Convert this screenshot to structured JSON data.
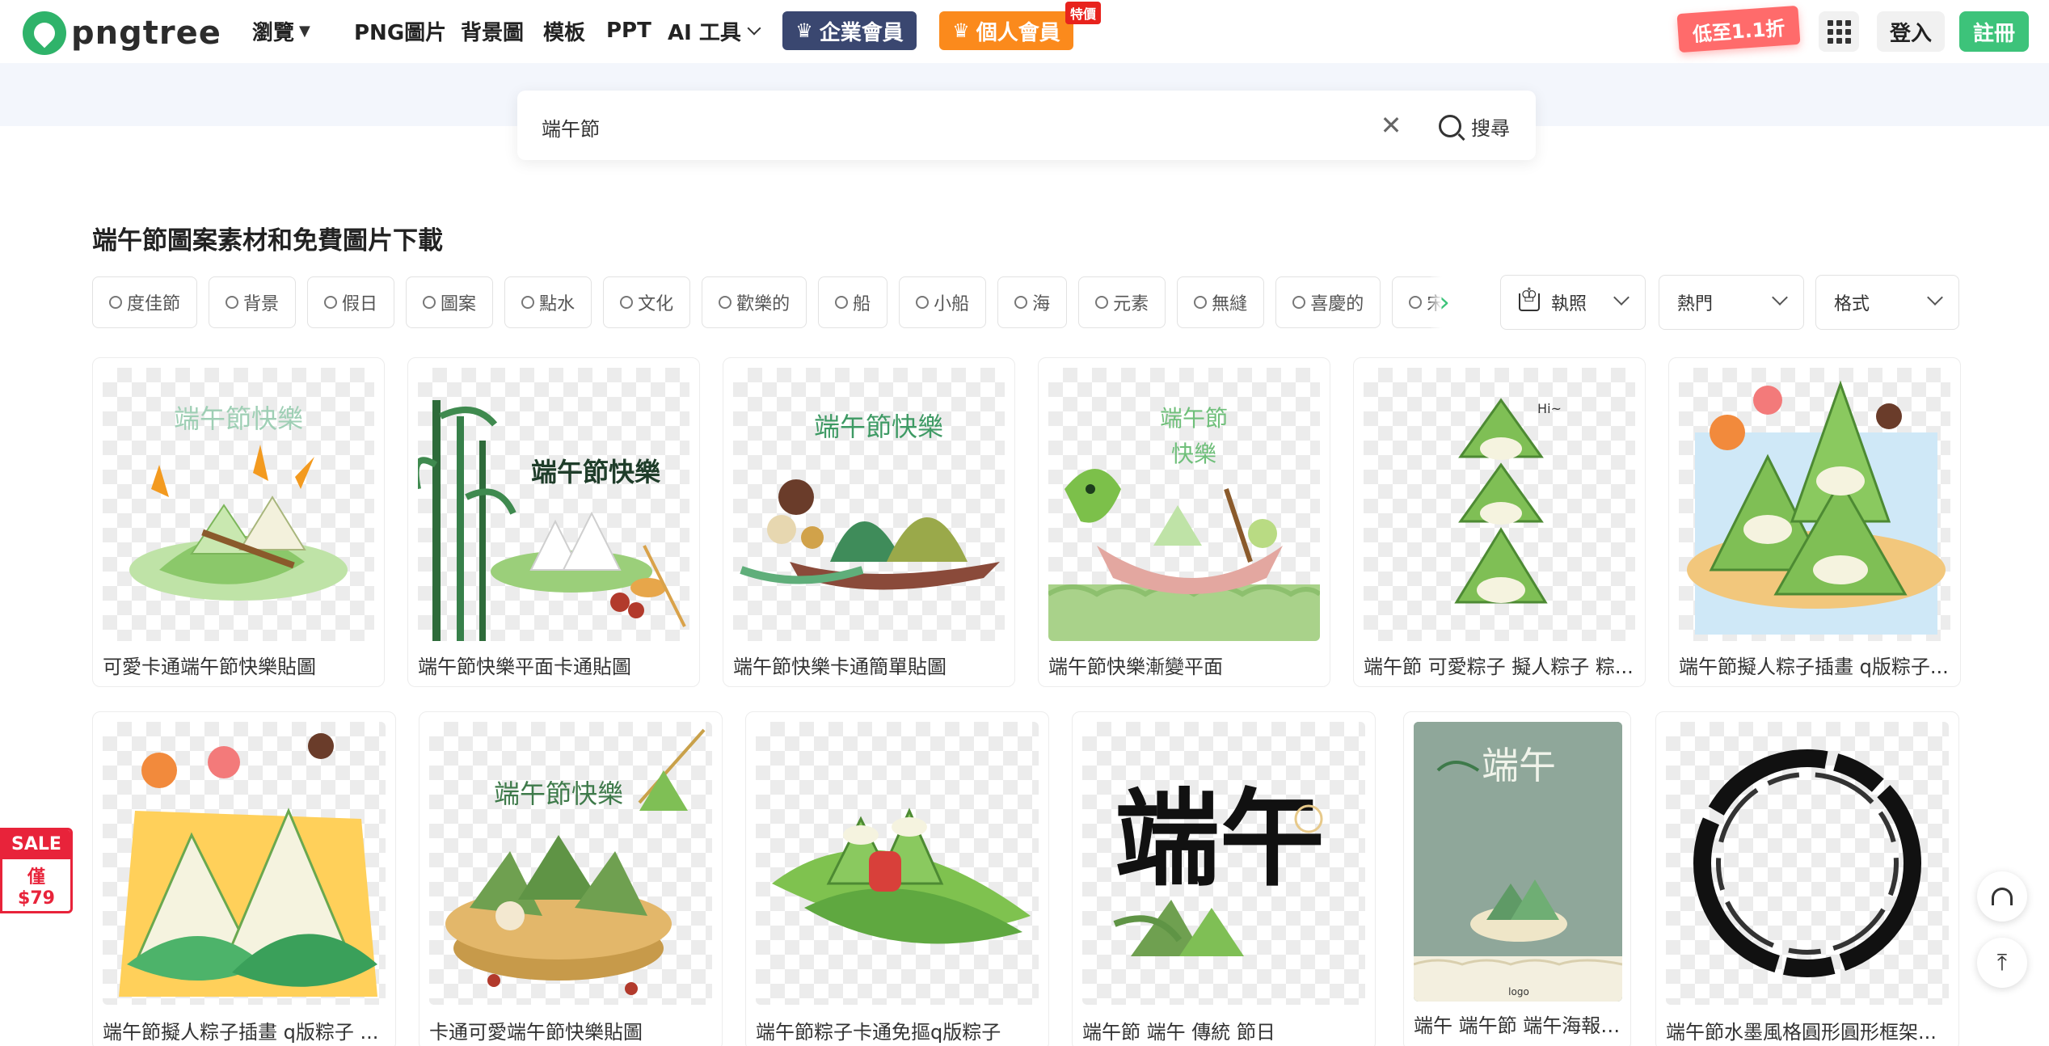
{
  "header": {
    "logo_text": "pngtree",
    "nav": [
      {
        "label": "瀏覽"
      },
      {
        "label": "PNG圖片"
      },
      {
        "label": "背景圖"
      },
      {
        "label": "模板"
      },
      {
        "label": "PPT"
      },
      {
        "label": "AI 工具"
      }
    ],
    "enterprise_label": "企業會員",
    "personal_label": "個人會員",
    "personal_badge": "特價",
    "promo_label": "低至1.1折",
    "login_label": "登入",
    "register_label": "註冊"
  },
  "search": {
    "value": "端午節",
    "button_label": "搜尋"
  },
  "page_title": "端午節圖案素材和免費圖片下載",
  "tags": [
    "度佳節",
    "背景",
    "假日",
    "圖案",
    "點水",
    "文化",
    "歡樂的",
    "船",
    "小船",
    "海",
    "元素",
    "無縫",
    "喜慶的",
    "宋"
  ],
  "filters": {
    "license": "執照",
    "sort": "熱門",
    "format": "格式"
  },
  "cards_row1": [
    {
      "title": "可愛卡通端午節快樂貼圖",
      "art_text": "端午節快樂"
    },
    {
      "title": "端午節快樂平面卡通貼圖",
      "art_text": "端午節快樂"
    },
    {
      "title": "端午節快樂卡通簡單貼圖",
      "art_text": "端午節快樂"
    },
    {
      "title": "端午節快樂漸變平面",
      "art_text": "端午節",
      "art_text2": "快樂"
    },
    {
      "title": "端午節 可愛粽子 擬人粽子 粽...",
      "art_text": "Hi~"
    },
    {
      "title": "端午節擬人粽子插畫 q版粽子..."
    }
  ],
  "cards_row2": [
    {
      "title": "端午節擬人粽子插畫 q版粽子 ..."
    },
    {
      "title": "卡通可愛端午節快樂貼圖",
      "art_text": "端午節快樂"
    },
    {
      "title": "端午節粽子卡通免摳q版粽子"
    },
    {
      "title": "端午節 端午 傳統 節日",
      "art_text": "端午"
    },
    {
      "title": "端午 端午節 端午海報 ...",
      "art_text": "端午",
      "art_text2": "logo"
    },
    {
      "title": "端午節水墨風格圓形圓形框架..."
    }
  ],
  "sale": {
    "top": "SALE",
    "mid": "僅",
    "price": "$79"
  },
  "colors": {
    "brand_green": "#3dc37a",
    "enterprise": "#3a4770",
    "personal": "#fb8a1c",
    "sale_red": "#e8233a"
  }
}
